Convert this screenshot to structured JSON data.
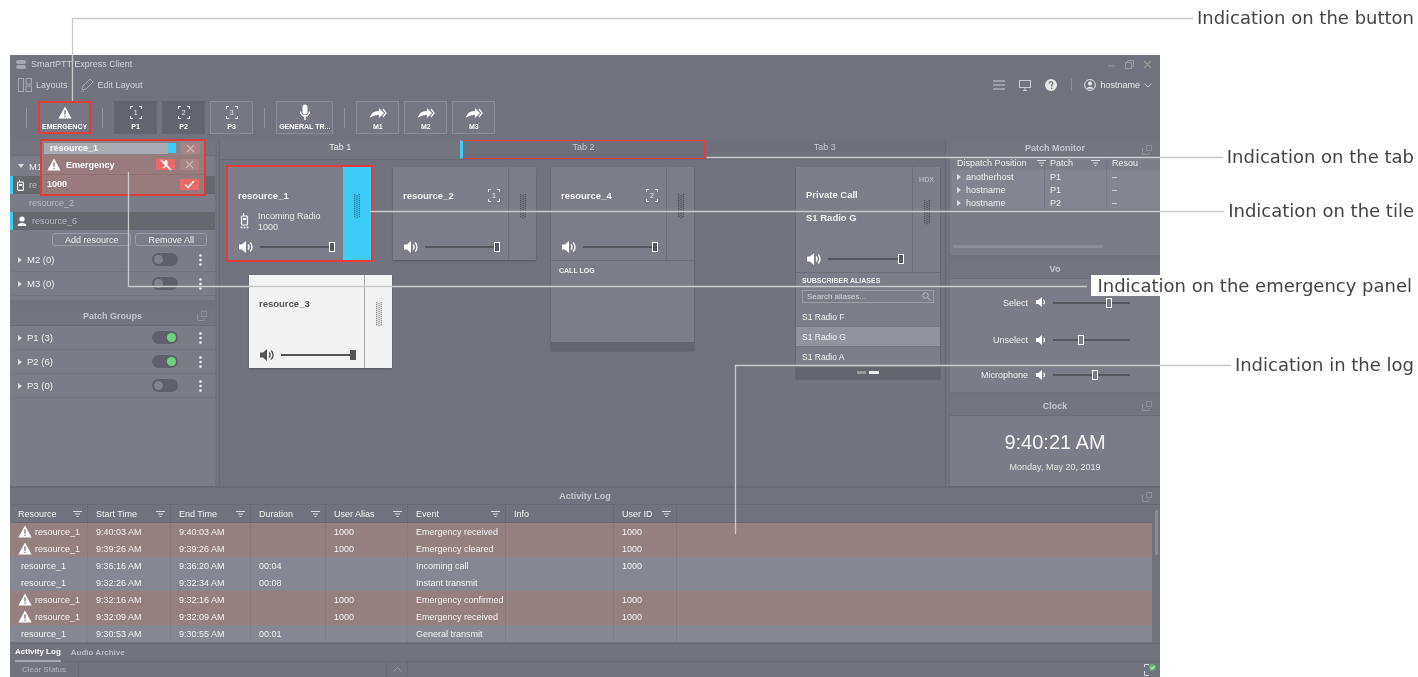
{
  "window": {
    "title": "SmartPTT Express Client"
  },
  "menu": [
    {
      "label": "Layouts",
      "kind": "layouts"
    },
    {
      "label": "Edit Layout",
      "kind": "edit"
    }
  ],
  "user": {
    "label": "hostname"
  },
  "toolbar": [
    [
      {
        "label": "EMERGENCY",
        "kind": "emergency",
        "alert": true
      }
    ],
    [
      {
        "label": "P1",
        "kind": "patch",
        "badge": "1",
        "active": true
      },
      {
        "label": "P2",
        "kind": "patch",
        "badge": "2",
        "active": true
      },
      {
        "label": "P3",
        "kind": "patch",
        "badge": "3",
        "active": false
      }
    ],
    [
      {
        "label": "GENERAL TR...",
        "kind": "mic",
        "active": false
      }
    ],
    [
      {
        "label": "M1",
        "kind": "multiselect",
        "active": false
      },
      {
        "label": "M2",
        "kind": "multiselect",
        "active": false
      },
      {
        "label": "M3",
        "kind": "multiselect",
        "active": false
      }
    ]
  ],
  "emergency_panel": {
    "resource": "resource_1",
    "alert": "Emergency",
    "caller": "1000"
  },
  "monitoring": {
    "groups": [
      {
        "label": "M1",
        "expanded": true,
        "resources": [
          {
            "name": "re",
            "kind": "radio",
            "on": true
          },
          {
            "name": "resource_2",
            "kind": "plain",
            "on": false
          },
          {
            "name": "resource_6",
            "kind": "talkgroup",
            "on": true
          }
        ],
        "buttons": [
          "Add resource",
          "Remove All"
        ]
      },
      {
        "label": "M2 (0)",
        "expanded": false,
        "on": false
      },
      {
        "label": "M3 (0)",
        "expanded": false,
        "on": false
      }
    ]
  },
  "patch_groups": {
    "title": "Patch Groups",
    "groups": [
      {
        "label": "P1 (3)",
        "on": true
      },
      {
        "label": "P2 (6)",
        "on": true
      },
      {
        "label": "P3 (0)",
        "on": false
      }
    ]
  },
  "tabs": [
    {
      "label": "Tab 1",
      "selected": true,
      "alert": false
    },
    {
      "label": "Tab 2",
      "selected": false,
      "alert": true
    },
    {
      "label": "Tab 3",
      "selected": false,
      "alert": false
    }
  ],
  "tiles": [
    {
      "kind": "resource",
      "name": "resource_1",
      "alert": true,
      "selected": false,
      "status": [
        "Incoming Radio",
        "1000"
      ],
      "level": 1
    },
    {
      "kind": "resource",
      "name": "resource_2",
      "badge": "1",
      "alert": false,
      "selected": false,
      "level": 1
    },
    {
      "kind": "resource",
      "name": "resource_4",
      "badge": "2",
      "alert": false,
      "selected": false,
      "level": 1,
      "call_log": "CALL LOG"
    },
    {
      "kind": "private_call",
      "tag": "HDX",
      "title": "Private Call",
      "name": "S1 Radio G",
      "alert": false,
      "selected": false,
      "level": 1,
      "aliases": {
        "title": "SUBSCRIBER ALIASES",
        "placeholder": "Search aliases...",
        "items": [
          {
            "label": "S1 Radio F",
            "selected": false
          },
          {
            "label": "S1 Radio G",
            "selected": true
          },
          {
            "label": "S1 Radio A",
            "selected": false
          }
        ]
      }
    },
    {
      "kind": "resource",
      "name": "resource_3",
      "alert": false,
      "selected": true,
      "level": 1
    }
  ],
  "patch_monitor": {
    "title": "Patch Monitor",
    "columns": [
      {
        "label": "Dispatch Position",
        "filter": true
      },
      {
        "label": "Patch",
        "filter": true
      },
      {
        "label": "Resou",
        "filter": false
      }
    ],
    "rows": [
      [
        "anotherhost",
        "P1",
        "–"
      ],
      [
        "hostname",
        "P1",
        "–"
      ],
      [
        "hostname",
        "P2",
        "–"
      ]
    ]
  },
  "volume": {
    "title": "Vo",
    "rows": [
      {
        "label": "Select",
        "level": 0.75
      },
      {
        "label": "Unselect",
        "level": 0.35
      },
      {
        "label": "Microphone",
        "level": 0.55
      }
    ]
  },
  "clock": {
    "title": "Clock",
    "time": "9:40:21 AM",
    "date": "Monday, May 20, 2019"
  },
  "activity_log": {
    "title": "Activity Log",
    "columns": [
      {
        "label": "Resource",
        "filter": true
      },
      {
        "label": "Start Time",
        "filter": true
      },
      {
        "label": "End Time",
        "filter": true
      },
      {
        "label": "Duration",
        "filter": true
      },
      {
        "label": "User Alias",
        "filter": true
      },
      {
        "label": "Event",
        "filter": true
      },
      {
        "label": "Info",
        "filter": false
      },
      {
        "label": "User ID",
        "filter": true
      }
    ],
    "rows": [
      {
        "emergency": true,
        "cells": [
          "resource_1",
          "9:40:03 AM",
          "9:40:03 AM",
          "",
          "1000",
          "Emergency received",
          "",
          "1000"
        ]
      },
      {
        "emergency": true,
        "cells": [
          "resource_1",
          "9:39:26 AM",
          "9:39:26 AM",
          "",
          "1000",
          "Emergency cleared",
          "",
          "1000"
        ]
      },
      {
        "emergency": false,
        "cells": [
          "resource_1",
          "9:36:16 AM",
          "9:36:20 AM",
          "00:04",
          "",
          "Incoming call",
          "",
          "1000"
        ]
      },
      {
        "emergency": false,
        "cells": [
          "resource_1",
          "9:32:26 AM",
          "9:32:34 AM",
          "00:08",
          "",
          "Instant transmit",
          "",
          ""
        ]
      },
      {
        "emergency": true,
        "cells": [
          "resource_1",
          "9:32:16 AM",
          "9:32:16 AM",
          "",
          "1000",
          "Emergency confirmed",
          "",
          "1000"
        ]
      },
      {
        "emergency": true,
        "cells": [
          "resource_1",
          "9:32:09 AM",
          "9:32:09 AM",
          "",
          "1000",
          "Emergency received",
          "",
          "1000"
        ]
      },
      {
        "emergency": false,
        "cells": [
          "resource_1",
          "9:30:53 AM",
          "9:30:55 AM",
          "00:01",
          "",
          "General transmit",
          "",
          ""
        ]
      }
    ]
  },
  "bottom_tabs": [
    {
      "label": "Activity Log",
      "selected": true
    },
    {
      "label": "Audio Archive",
      "selected": false
    }
  ],
  "status_bar": {
    "button": "Clear Status",
    "disabled": true
  },
  "annotations": [
    {
      "text": "Indication on the button"
    },
    {
      "text": "Indication on the tab"
    },
    {
      "text": "Indication on the tile"
    },
    {
      "text": "Indication on the emergency panel"
    },
    {
      "text": "Indication in the log"
    }
  ]
}
